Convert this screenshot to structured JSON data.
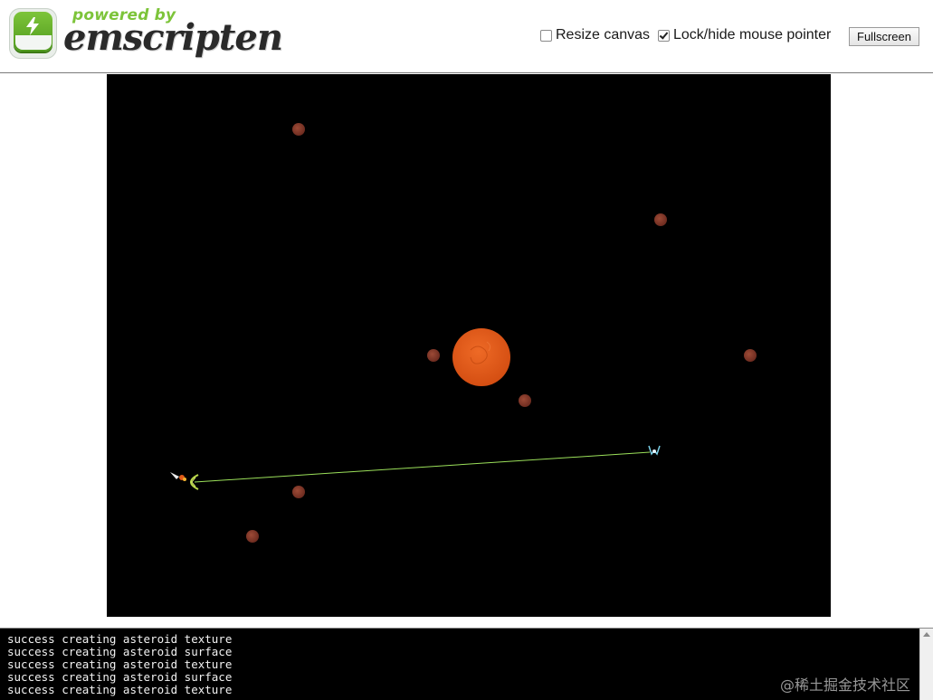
{
  "logo": {
    "powered_by": "powered by",
    "wordmark": "emscripten"
  },
  "controls": {
    "resize_canvas": {
      "label": "Resize canvas",
      "checked": false
    },
    "lock_pointer": {
      "label": "Lock/hide mouse pointer",
      "checked": true
    },
    "fullscreen_label": "Fullscreen"
  },
  "game": {
    "planet_color": "#e05a18",
    "asteroid_color": "#8a3a2a",
    "laser_color": "#9be05a",
    "background": "#000000"
  },
  "console": {
    "lines": [
      "success creating asteroid texture",
      "success creating asteroid surface",
      "success creating asteroid texture",
      "success creating asteroid surface",
      "success creating asteroid texture"
    ]
  },
  "watermark": "@稀土掘金技术社区"
}
